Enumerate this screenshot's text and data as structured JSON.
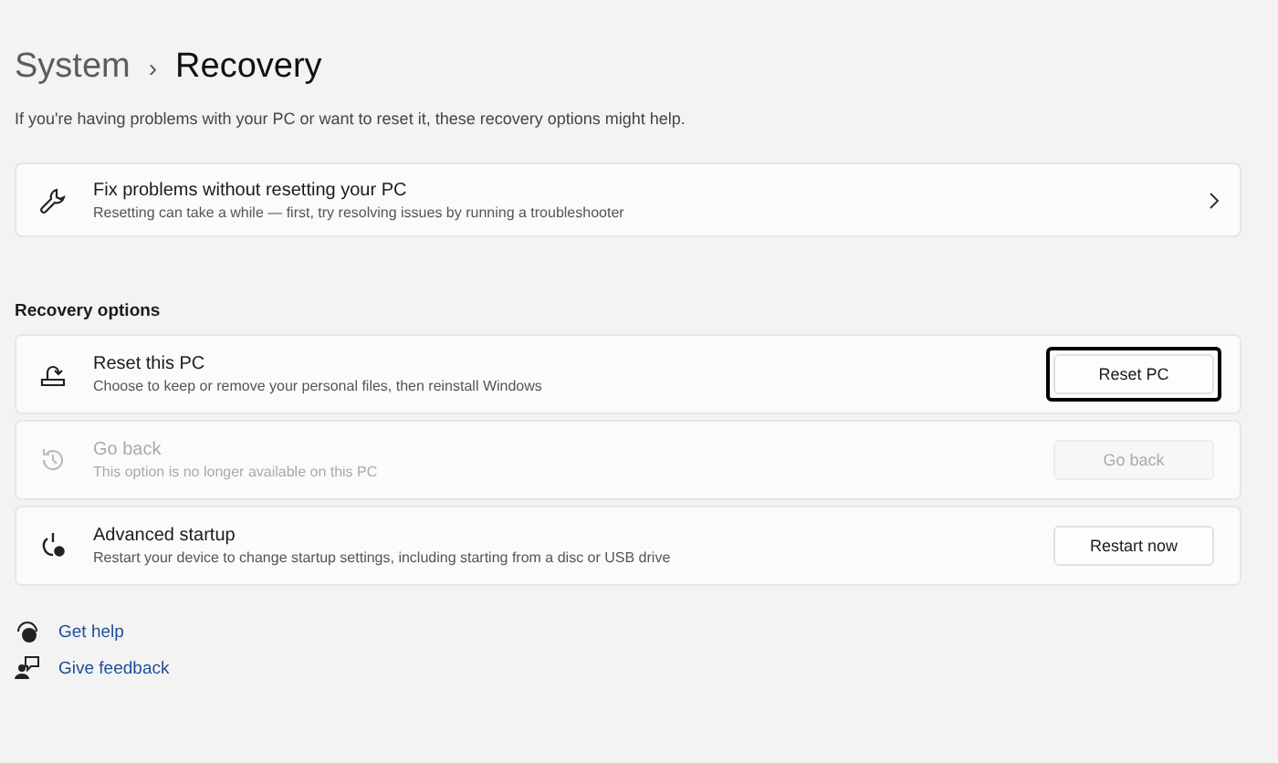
{
  "breadcrumb": {
    "parent": "System",
    "separator": "›",
    "current": "Recovery"
  },
  "description": "If you're having problems with your PC or want to reset it, these recovery options might help.",
  "fix_card": {
    "title": "Fix problems without resetting your PC",
    "subtitle": "Resetting can take a while — first, try resolving issues by running a troubleshooter"
  },
  "section_title": "Recovery options",
  "options": [
    {
      "kind": "reset",
      "title": "Reset this PC",
      "subtitle": "Choose to keep or remove your personal files, then reinstall Windows",
      "button": "Reset PC",
      "focused": true,
      "disabled": false
    },
    {
      "kind": "history",
      "title": "Go back",
      "subtitle": "This option is no longer available on this PC",
      "button": "Go back",
      "focused": false,
      "disabled": true
    },
    {
      "kind": "startup",
      "title": "Advanced startup",
      "subtitle": "Restart your device to change startup settings, including starting from a disc or USB drive",
      "button": "Restart now",
      "focused": false,
      "disabled": false
    }
  ],
  "help_links": [
    {
      "kind": "help",
      "label": "Get help"
    },
    {
      "kind": "feedback",
      "label": "Give feedback"
    }
  ]
}
